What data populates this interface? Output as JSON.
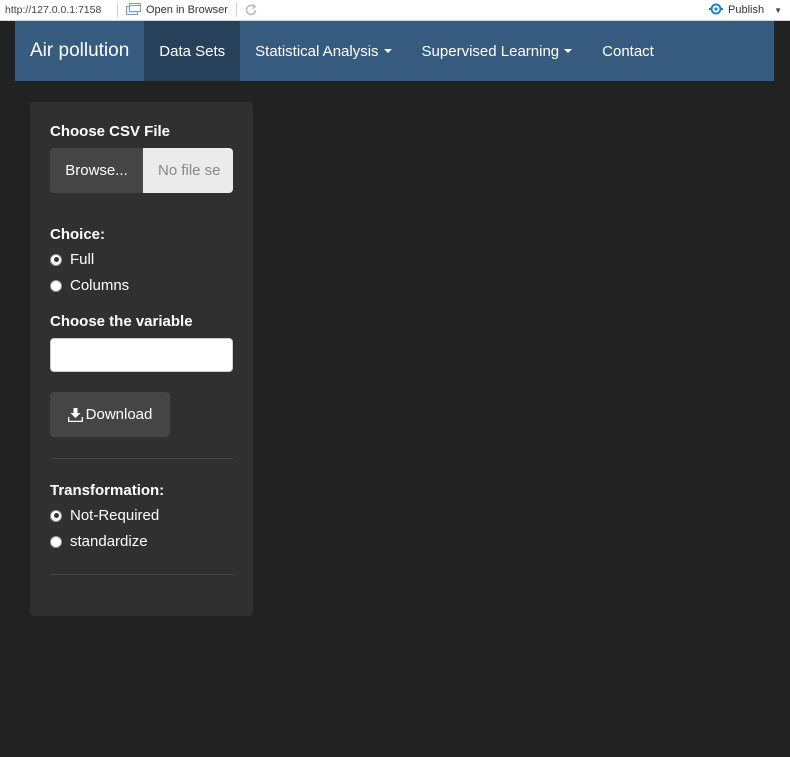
{
  "viewer": {
    "url": "http://127.0.0.1:7158",
    "open_in_browser": "Open in Browser",
    "publish": "Publish"
  },
  "navbar": {
    "brand": "Air pollution",
    "items": [
      {
        "label": "Data Sets",
        "active": true
      },
      {
        "label": "Statistical Analysis",
        "dropdown": true
      },
      {
        "label": "Supervised Learning",
        "dropdown": true
      },
      {
        "label": "Contact"
      }
    ]
  },
  "sidebar": {
    "file_label": "Choose CSV File",
    "browse_label": "Browse...",
    "file_placeholder": "No file se",
    "choice_label": "Choice:",
    "choice_options": [
      "Full",
      "Columns"
    ],
    "choice_selected": "Full",
    "variable_label": "Choose the variable",
    "variable_value": "",
    "download_label": "Download",
    "transformation_label": "Transformation:",
    "transformation_options": [
      "Not-Required",
      "standardize"
    ],
    "transformation_selected": "Not-Required"
  },
  "colors": {
    "background": "#222222",
    "navbar": "#375a7f",
    "navbar_active": "#28415b",
    "well": "#303030",
    "button": "#464545"
  },
  "icons": [
    "open-in-browser-icon",
    "refresh-icon",
    "publish-icon",
    "download-icon"
  ]
}
